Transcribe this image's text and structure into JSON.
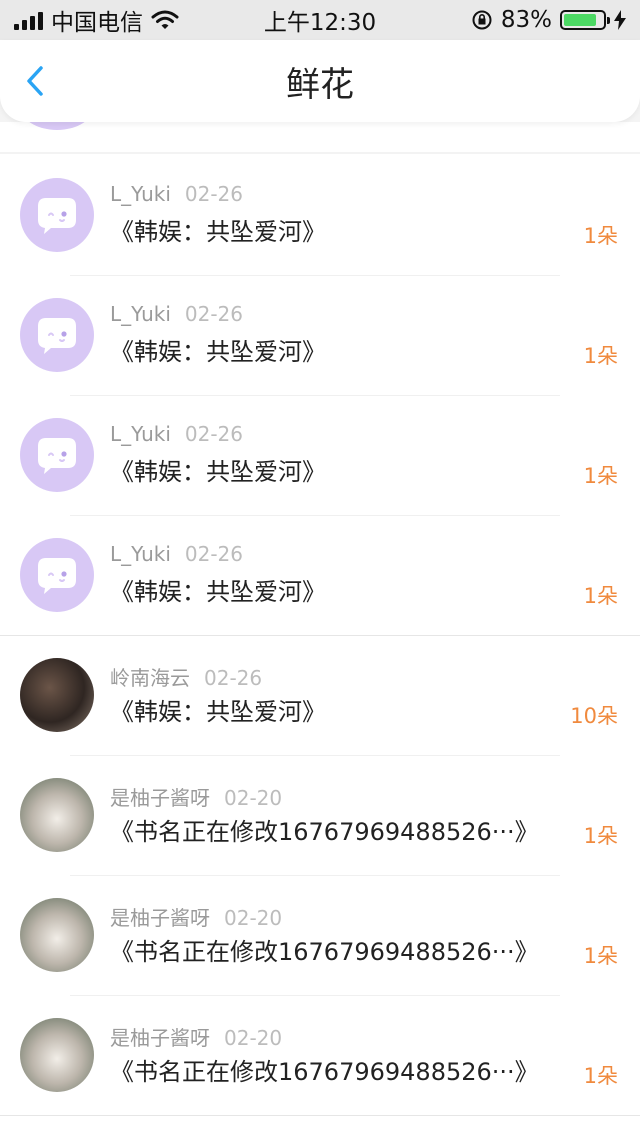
{
  "status_bar": {
    "carrier": "中国电信",
    "time": "上午12:30",
    "battery_percent": "83%",
    "battery_level": 0.83
  },
  "nav": {
    "title": "鲜花",
    "back_icon": "chevron-left-icon"
  },
  "colors": {
    "accent_blue": "#2aa4f4",
    "count_orange": "#f08a3e",
    "default_avatar": "#d8c8f5",
    "battery_green": "#4cd964"
  },
  "items": [
    {
      "user": "L_Yuki",
      "date": "02-26",
      "book": "《韩娱：共坠爱河》",
      "count": "1朵"
    },
    {
      "user": "L_Yuki",
      "date": "02-26",
      "book": "《韩娱：共坠爱河》",
      "count": "1朵"
    },
    {
      "user": "L_Yuki",
      "date": "02-26",
      "book": "《韩娱：共坠爱河》",
      "count": "1朵"
    },
    {
      "user": "L_Yuki",
      "date": "02-26",
      "book": "《韩娱：共坠爱河》",
      "count": "1朵"
    },
    {
      "user": "岭南海云",
      "date": "02-26",
      "book": "《韩娱：共坠爱河》",
      "count": "10朵"
    },
    {
      "user": "是柚子酱呀",
      "date": "02-20",
      "book": "《书名正在修改16767969488526···》",
      "count": "1朵"
    },
    {
      "user": "是柚子酱呀",
      "date": "02-20",
      "book": "《书名正在修改16767969488526···》",
      "count": "1朵"
    },
    {
      "user": "是柚子酱呀",
      "date": "02-20",
      "book": "《书名正在修改16767969488526···》",
      "count": "1朵"
    }
  ]
}
